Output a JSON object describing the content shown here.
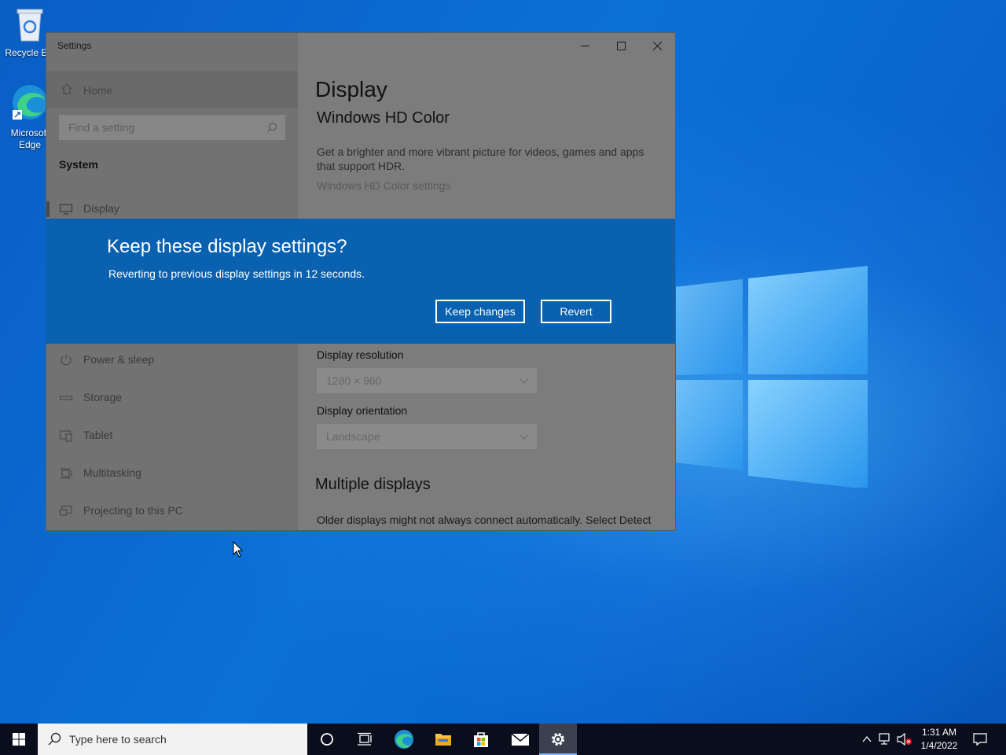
{
  "desktop": {
    "icons": [
      {
        "label": "Recycle Bin",
        "name": "recycle-bin"
      },
      {
        "label_line1": "Microsoft",
        "label_line2": "Edge",
        "name": "microsoft-edge"
      }
    ]
  },
  "window": {
    "title": "Settings",
    "controls": {
      "minimize": "minimize",
      "maximize": "maximize",
      "close": "close"
    }
  },
  "sidebar": {
    "home_label": "Home",
    "search_placeholder": "Find a setting",
    "section_header": "System",
    "items": [
      {
        "label": "Display",
        "icon": "monitor-icon",
        "active": true
      },
      {
        "label": "Power & sleep",
        "icon": "power-icon"
      },
      {
        "label": "Storage",
        "icon": "storage-icon"
      },
      {
        "label": "Tablet",
        "icon": "tablet-icon"
      },
      {
        "label": "Multitasking",
        "icon": "multitasking-icon"
      },
      {
        "label": "Projecting to this PC",
        "icon": "projecting-icon"
      }
    ]
  },
  "main": {
    "page_title": "Display",
    "hdr_heading": "Windows HD Color",
    "hdr_desc": "Get a brighter and more vibrant picture for videos, games and apps that support HDR.",
    "hdr_link": "Windows HD Color settings",
    "resolution_label": "Display resolution",
    "resolution_value": "1280 × 960",
    "orientation_label": "Display orientation",
    "orientation_value": "Landscape",
    "multiple_heading": "Multiple displays",
    "multiple_desc": "Older displays might not always connect automatically. Select Detect"
  },
  "dialog": {
    "question": "Keep these display settings?",
    "message": "Reverting to previous display settings in 12 seconds.",
    "keep_label": "Keep changes",
    "revert_label": "Revert",
    "seconds_remaining": 12
  },
  "taskbar": {
    "search_placeholder": "Type here to search",
    "pinned": [
      "cortana-icon",
      "task-view-icon",
      "edge-icon",
      "file-explorer-icon",
      "store-icon",
      "mail-icon",
      "settings-icon"
    ],
    "active_app": "settings-icon",
    "time": "1:31 AM",
    "date": "1/4/2022"
  },
  "colors": {
    "dialog_bg": "#0a61b0",
    "taskbar_bg": "#0a0e1c",
    "desktop_bg": "#0b63c9"
  }
}
